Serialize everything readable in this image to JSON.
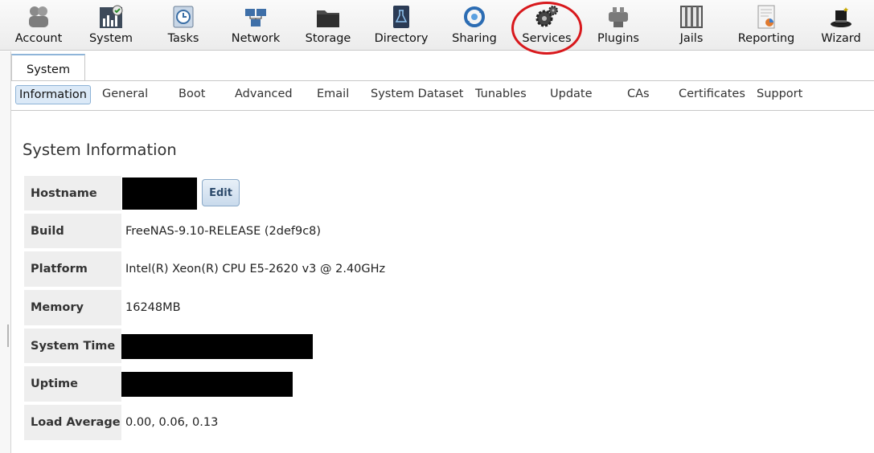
{
  "toolbar": {
    "items": [
      {
        "label": "Account",
        "icon": "account-icon"
      },
      {
        "label": "System",
        "icon": "system-icon"
      },
      {
        "label": "Tasks",
        "icon": "tasks-icon"
      },
      {
        "label": "Network",
        "icon": "network-icon"
      },
      {
        "label": "Storage",
        "icon": "storage-icon"
      },
      {
        "label": "Directory",
        "icon": "directory-icon"
      },
      {
        "label": "Sharing",
        "icon": "sharing-icon"
      },
      {
        "label": "Services",
        "icon": "services-icon"
      },
      {
        "label": "Plugins",
        "icon": "plugins-icon"
      },
      {
        "label": "Jails",
        "icon": "jails-icon"
      },
      {
        "label": "Reporting",
        "icon": "reporting-icon"
      },
      {
        "label": "Wizard",
        "icon": "wizard-icon"
      }
    ]
  },
  "main_tab": {
    "label": "System"
  },
  "subtabs": [
    {
      "label": "Information",
      "active": true
    },
    {
      "label": "General"
    },
    {
      "label": "Boot"
    },
    {
      "label": "Advanced"
    },
    {
      "label": "Email"
    },
    {
      "label": "System Dataset"
    },
    {
      "label": "Tunables"
    },
    {
      "label": "Update"
    },
    {
      "label": "CAs"
    },
    {
      "label": "Certificates"
    },
    {
      "label": "Support"
    }
  ],
  "section_title": "System Information",
  "info": {
    "rows": [
      {
        "label": "Hostname",
        "value": "",
        "redacted": true
      },
      {
        "label": "Build",
        "value": "FreeNAS-9.10-RELEASE (2def9c8)"
      },
      {
        "label": "Platform",
        "value": "Intel(R) Xeon(R) CPU E5-2620 v3 @ 2.40GHz"
      },
      {
        "label": "Memory",
        "value": "16248MB"
      },
      {
        "label": "System Time",
        "value": "",
        "redacted": true
      },
      {
        "label": "Uptime",
        "value": "",
        "redacted": true
      },
      {
        "label": "Load Average",
        "value": "0.00, 0.06, 0.13"
      }
    ],
    "edit_label": "Edit"
  },
  "colors": {
    "highlight_circle": "#d8181c",
    "active_tab_bg": "#dbe9f7",
    "label_bg": "#eeeeee"
  }
}
